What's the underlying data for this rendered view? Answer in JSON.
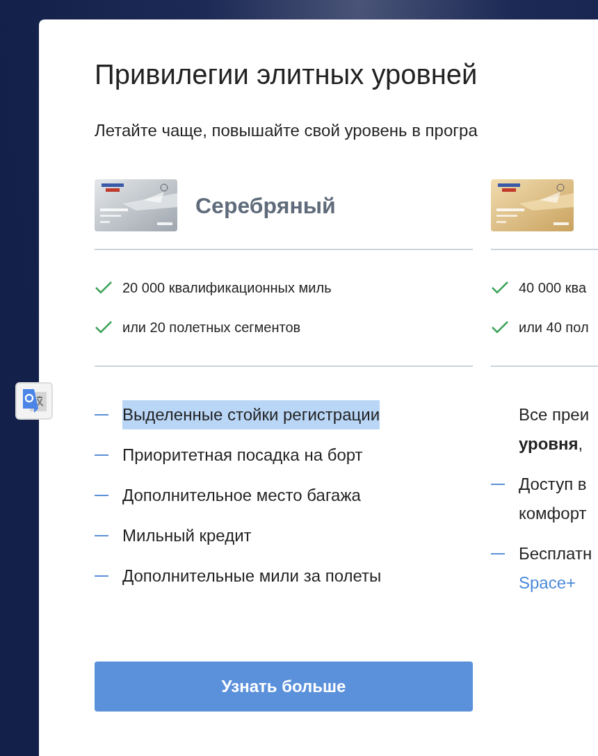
{
  "title": "Привилегии элитных уровней",
  "subtitle": "Летайте чаще, повышайте свой уровень в програ",
  "tiers": [
    {
      "kind": "silver",
      "name": "Серебряный",
      "requirements": [
        "20 000 квалификационных миль",
        "или 20 полетных сегментов"
      ],
      "benefits": [
        {
          "kind": "item",
          "highlighted": true,
          "lines": [
            {
              "text": "Выделенные стойки регистрации",
              "link": false
            }
          ]
        },
        {
          "kind": "item",
          "highlighted": false,
          "lines": [
            {
              "text": "Приоритетная посадка на борт",
              "link": false
            }
          ]
        },
        {
          "kind": "item",
          "highlighted": false,
          "lines": [
            {
              "text": "Дополнительное место багажа",
              "link": false
            }
          ]
        },
        {
          "kind": "item",
          "highlighted": false,
          "lines": [
            {
              "text": "Мильный кредит",
              "link": false
            }
          ]
        },
        {
          "kind": "item",
          "highlighted": false,
          "lines": [
            {
              "text": "Дополнительные мили за полеты",
              "link": false
            }
          ]
        }
      ],
      "button": "Узнать больше"
    },
    {
      "kind": "gold",
      "requirements": [
        "40 000 ква",
        "или 40 пол"
      ],
      "benefits": [
        {
          "kind": "intro",
          "highlighted": false,
          "lines": [
            {
              "text": "Все преи",
              "link": false
            },
            {
              "text": "**уровня**,",
              "link": false
            }
          ]
        },
        {
          "kind": "item",
          "highlighted": false,
          "lines": [
            {
              "text": "Доступ в",
              "link": false
            },
            {
              "text": "комфорт",
              "link": false
            }
          ]
        },
        {
          "kind": "item",
          "highlighted": false,
          "lines": [
            {
              "text": "Бесплатн",
              "link": false
            },
            {
              "text": "Space+",
              "link": true
            }
          ]
        }
      ]
    }
  ]
}
